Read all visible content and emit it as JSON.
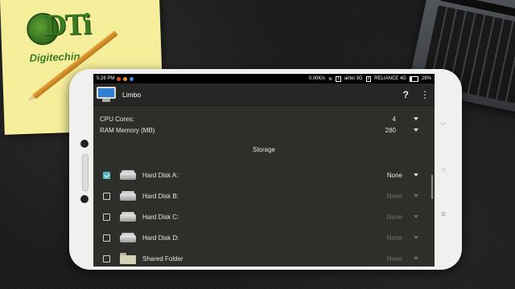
{
  "watermark": {
    "brand": "DTi",
    "tagline": "Digitechin."
  },
  "statusbar": {
    "time": "5:26 PM",
    "speed": "0.00K/s",
    "sim1": "1",
    "carrier1": "airtel 3G",
    "sim2": "2",
    "carrier2": "RELIANCE 4G",
    "battery": "28%"
  },
  "toolbar": {
    "title": "Limbo",
    "help": "?",
    "menu": "⋮"
  },
  "settings": [
    {
      "label": "CPU Cores:",
      "value": "4"
    },
    {
      "label": "RAM Memory (MB)",
      "value": "280"
    }
  ],
  "storage": {
    "title": "Storage",
    "items": [
      {
        "label": "Hard Disk A:",
        "value": "None",
        "checked": true,
        "icon": "hard-disk-icon"
      },
      {
        "label": "Hard Disk B:",
        "value": "None",
        "checked": false,
        "icon": "hard-disk-icon"
      },
      {
        "label": "Hard Disk C:",
        "value": "None",
        "checked": false,
        "icon": "hard-disk-icon"
      },
      {
        "label": "Hard Disk D:",
        "value": "None",
        "checked": false,
        "icon": "hard-disk-icon"
      },
      {
        "label": "Shared Folder",
        "value": "None",
        "checked": false,
        "icon": "folder-icon"
      }
    ]
  },
  "colors": {
    "accent": "#59b7c4",
    "background": "#2e2f2b",
    "toolbar": "#262724"
  }
}
